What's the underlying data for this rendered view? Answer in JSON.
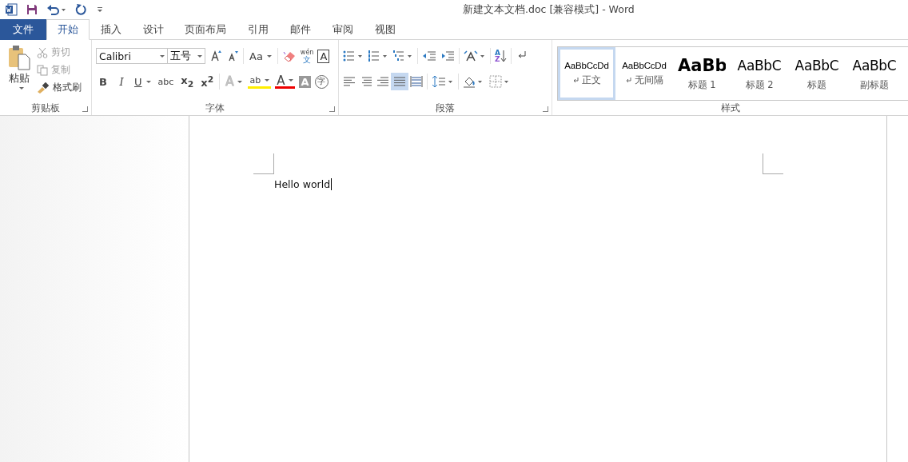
{
  "title": "新建文本文档.doc [兼容模式] - Word",
  "tabs": [
    {
      "label": "文件",
      "kind": "file",
      "selected": false
    },
    {
      "label": "开始",
      "kind": "tab",
      "selected": true
    },
    {
      "label": "插入",
      "kind": "tab",
      "selected": false
    },
    {
      "label": "设计",
      "kind": "tab",
      "selected": false
    },
    {
      "label": "页面布局",
      "kind": "tab",
      "selected": false
    },
    {
      "label": "引用",
      "kind": "tab",
      "selected": false
    },
    {
      "label": "邮件",
      "kind": "tab",
      "selected": false
    },
    {
      "label": "审阅",
      "kind": "tab",
      "selected": false
    },
    {
      "label": "视图",
      "kind": "tab",
      "selected": false
    }
  ],
  "clipboard": {
    "paste": "粘贴",
    "cut": {
      "label": "剪切",
      "disabled": true
    },
    "copy": {
      "label": "复制",
      "disabled": true
    },
    "format_painter": {
      "label": "格式刷",
      "disabled": false
    },
    "group_label": "剪贴板"
  },
  "font": {
    "name": "Calibri",
    "size": "五号",
    "case_button": "Aa",
    "phonetic": [
      "wén",
      "文"
    ],
    "border_letter": "A",
    "format_buttons": [
      {
        "label": "B",
        "kind": "bold"
      },
      {
        "label": "I",
        "kind": "italic"
      },
      {
        "label": "U",
        "kind": "underline"
      },
      {
        "label": "abc",
        "kind": "strike"
      },
      {
        "label": "x$_{2}$",
        "kind": "plain"
      },
      {
        "label": "x$^{2}$",
        "kind": "plain"
      }
    ],
    "effects_letter": "A",
    "highlight_letters": "ab",
    "font_color_letter": "A",
    "shading_letter": "A",
    "enclose": "字",
    "group_label": "字体"
  },
  "paragraph": {
    "alignments": [
      {
        "kind": "left",
        "selected": false
      },
      {
        "kind": "center",
        "selected": false
      },
      {
        "kind": "right",
        "selected": false
      },
      {
        "kind": "justify",
        "selected": true
      },
      {
        "kind": "distribute",
        "selected": false
      }
    ],
    "sort": [
      "A",
      "Z"
    ],
    "group_label": "段落"
  },
  "styles": {
    "items": [
      {
        "sample": "AaBbCcDd",
        "name": "正文",
        "kind": "para",
        "selected": true
      },
      {
        "sample": "AaBbCcDd",
        "name": "无间隔",
        "kind": "para",
        "selected": false
      },
      {
        "sample": "AaBb",
        "name": "标题 1",
        "kind": "heading1",
        "selected": false
      },
      {
        "sample": "AaBbC",
        "name": "标题 2",
        "kind": "heading",
        "selected": false
      },
      {
        "sample": "AaBbC",
        "name": "标题",
        "kind": "heading",
        "selected": false
      },
      {
        "sample": "AaBbC",
        "name": "副标题",
        "kind": "heading",
        "selected": false
      }
    ],
    "group_label": "样式"
  },
  "document": {
    "text": "Hello world"
  }
}
